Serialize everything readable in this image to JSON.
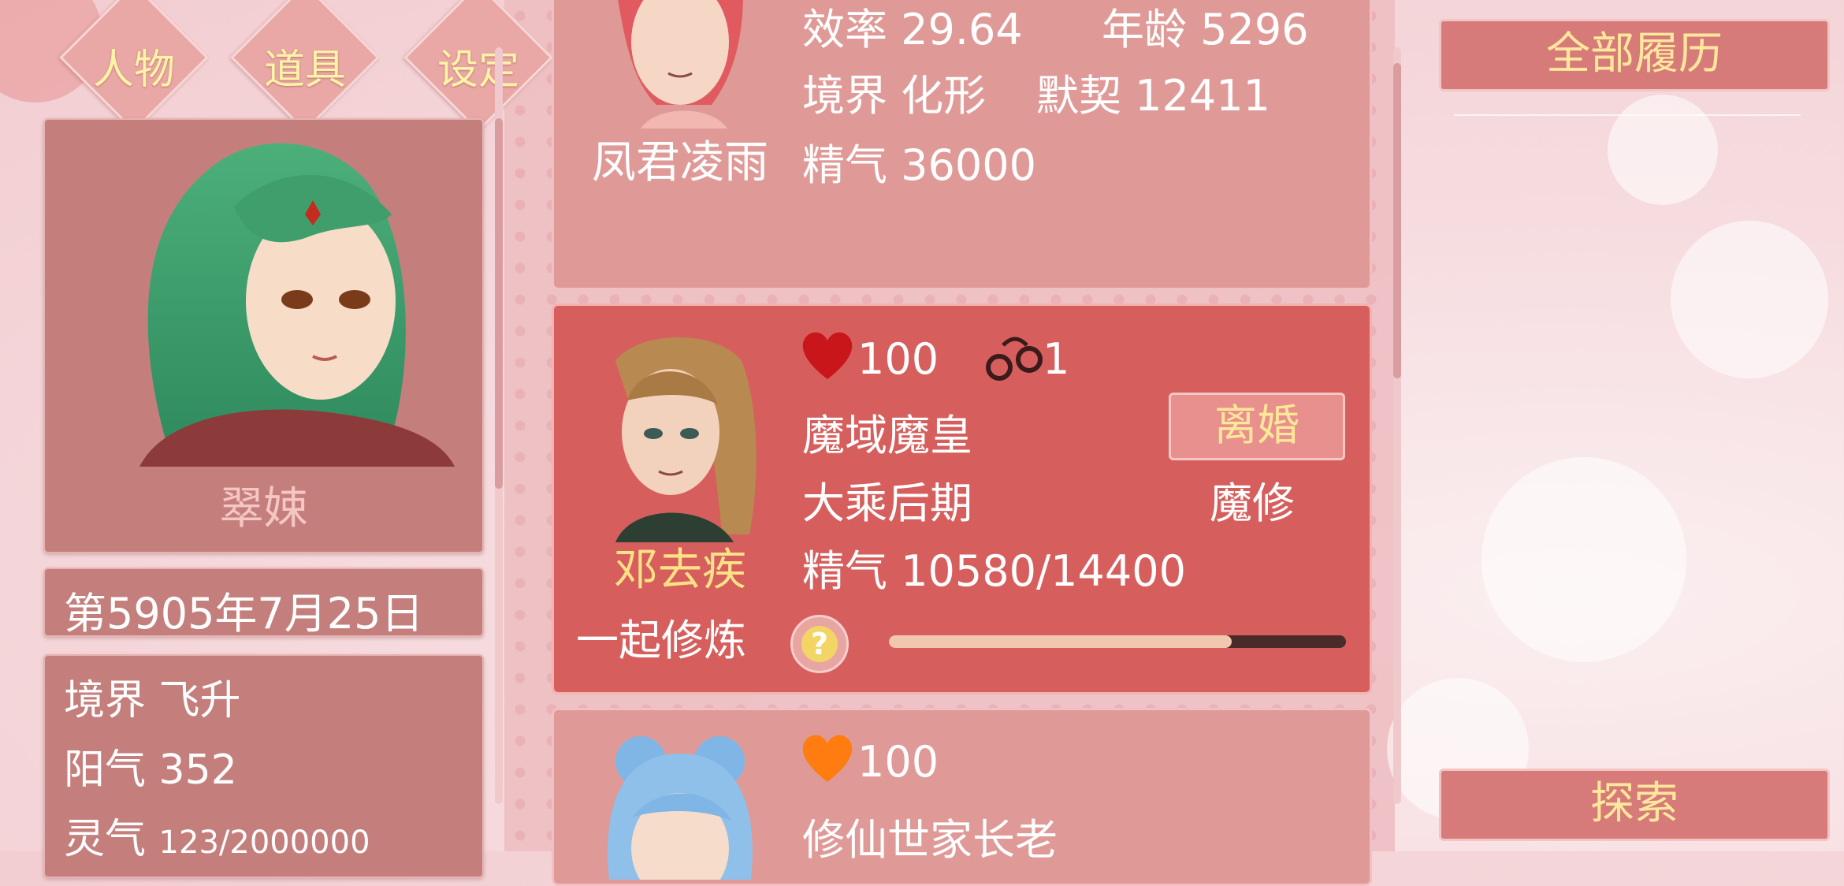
{
  "tabs": [
    {
      "label": "人物"
    },
    {
      "label": "道具"
    },
    {
      "label": "设定"
    }
  ],
  "player": {
    "name": "翠娕",
    "date": "第5905年7月25日",
    "stats": {
      "realm": "境界 飞升",
      "yang": "阳气 352",
      "spirit_label": "灵气",
      "spirit_value": "123/2000000"
    }
  },
  "cards": [
    {
      "name": "凤君凌雨",
      "efficiency": "效率 29.64",
      "age": "年龄 5296",
      "realm": "境界 化形",
      "tacit": "默契 12411",
      "essence": "精气 36000"
    },
    {
      "name": "邓去疾",
      "affection": "100",
      "handcuffs": "1",
      "title": "魔域魔皇",
      "realm": "大乘后期",
      "cultivation_type": "魔修",
      "essence": "精气 10580/14400",
      "divorce_label": "离婚",
      "train_label": "一起修炼",
      "help_glyph": "?",
      "progress": 0.75
    },
    {
      "affection": "100",
      "title": "修仙世家长老"
    }
  ],
  "right_panel": {
    "history_label": "全部履历",
    "explore_label": "探索"
  },
  "colors": {
    "heart_red": "#c8161b",
    "heart_orange": "#ff7d10",
    "gold_text": "#ffe187"
  }
}
